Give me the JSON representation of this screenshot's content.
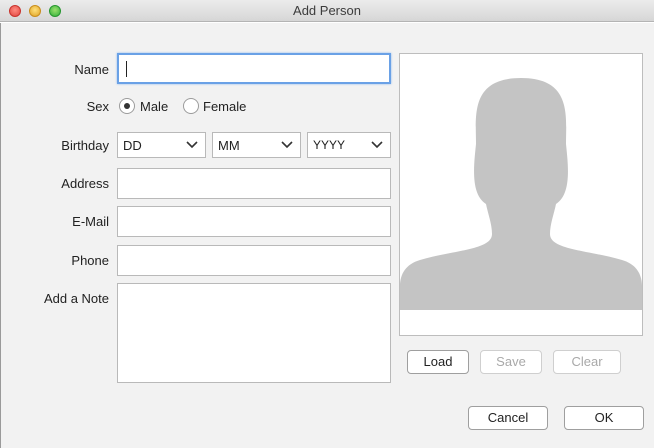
{
  "window": {
    "title": "Add Person"
  },
  "form": {
    "name_label": "Name",
    "name_value": "",
    "sex_label": "Sex",
    "sex_options": [
      "Male",
      "Female"
    ],
    "sex_selected": "Male",
    "birthday_label": "Birthday",
    "birthday_day": "DD",
    "birthday_month": "MM",
    "birthday_year": "YYYY",
    "address_label": "Address",
    "email_label": "E-Mail",
    "phone_label": "Phone",
    "note_label": "Add a Note"
  },
  "photo": {
    "placeholder_icon": "person-silhouette-icon",
    "load_label": "Load",
    "save_label": "Save",
    "clear_label": "Clear"
  },
  "footer": {
    "cancel_label": "Cancel",
    "ok_label": "OK"
  },
  "colors": {
    "focus_ring": "#6aa1e6",
    "silhouette": "#c4c4c4"
  }
}
